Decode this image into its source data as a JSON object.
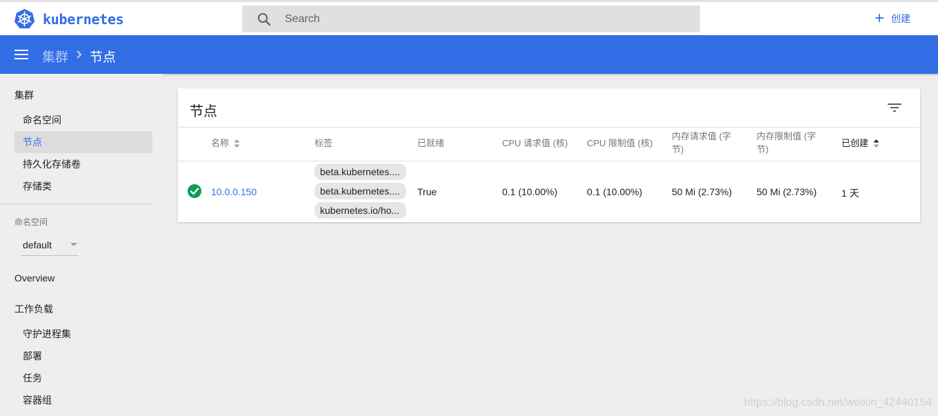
{
  "app": {
    "name": "kubernetes"
  },
  "search": {
    "placeholder": "Search"
  },
  "topbar": {
    "create_label": "创建"
  },
  "breadcrumb": {
    "parent": "集群",
    "current": "节点"
  },
  "sidebar": {
    "cluster_title": "集群",
    "cluster_items": [
      {
        "label": "命名空间",
        "active": false
      },
      {
        "label": "节点",
        "active": true
      },
      {
        "label": "持久化存储卷",
        "active": false
      },
      {
        "label": "存储类",
        "active": false
      }
    ],
    "namespace_label": "命名空间",
    "namespace_value": "default",
    "overview": "Overview",
    "workloads_title": "工作负载",
    "workload_items": [
      {
        "label": "守护进程集"
      },
      {
        "label": "部署"
      },
      {
        "label": "任务"
      },
      {
        "label": "容器组"
      }
    ]
  },
  "card": {
    "title": "节点",
    "columns": {
      "name": "名称",
      "labels": "标签",
      "ready": "已就绪",
      "cpu_requests": "CPU 请求值 (核)",
      "cpu_limits": "CPU 限制值 (核)",
      "mem_requests_1": "内存请求值 (字",
      "mem_requests_2": "节)",
      "mem_limits_1": "内存限制值 (字",
      "mem_limits_2": "节)",
      "created": "已创建"
    },
    "rows": [
      {
        "status": "ready",
        "name": "10.0.0.150",
        "labels": [
          "beta.kubernetes....",
          "beta.kubernetes....",
          "kubernetes.io/ho..."
        ],
        "ready": "True",
        "cpu_requests": "0.1 (10.00%)",
        "cpu_limits": "0.1 (10.00%)",
        "mem_requests": "50 Mi (2.73%)",
        "mem_limits": "50 Mi (2.73%)",
        "created": "1 天"
      }
    ]
  },
  "watermark": "https://blog.csdn.net/weixin_42440154",
  "colors": {
    "brand": "#326de6",
    "success": "#0f9d58"
  },
  "icons": [
    "kubernetes-logo-icon",
    "search-icon",
    "plus-icon",
    "menu-icon",
    "chevron-right-icon",
    "filter-icon",
    "sort-icon",
    "check-circle-icon",
    "dropdown-arrow-icon"
  ]
}
